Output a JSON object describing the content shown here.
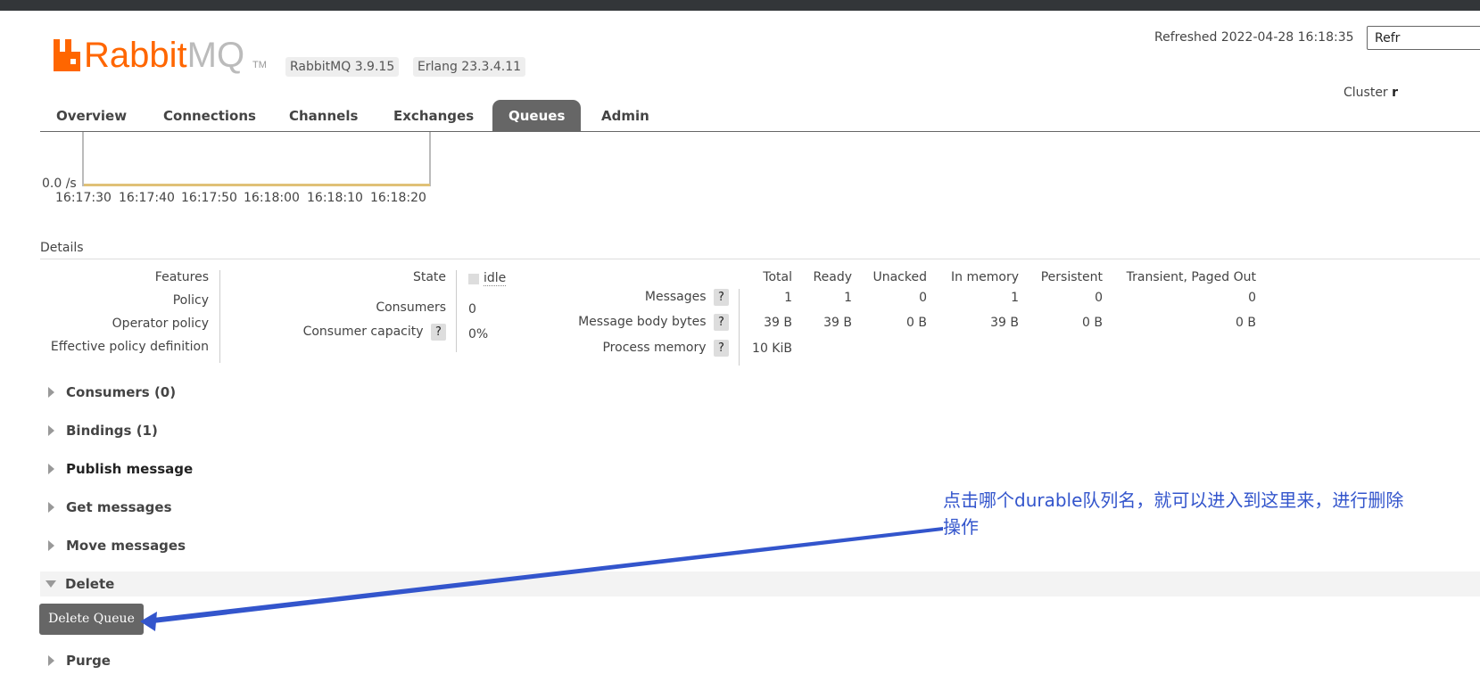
{
  "header": {
    "logo_text_rabbit": "Rabbit",
    "logo_text_mq": "MQ",
    "logo_tm": "TM",
    "rabbitmq_version": "RabbitMQ 3.9.15",
    "erlang_version": "Erlang 23.3.4.11",
    "refreshed": "Refreshed 2022-04-28 16:18:35",
    "refresh_button": "Refr",
    "cluster_label": "Cluster",
    "cluster_value": "r"
  },
  "nav": {
    "tabs": [
      {
        "label": "Overview"
      },
      {
        "label": "Connections"
      },
      {
        "label": "Channels"
      },
      {
        "label": "Exchanges"
      },
      {
        "label": "Queues",
        "active": true
      },
      {
        "label": "Admin"
      }
    ]
  },
  "chart_data": {
    "type": "line",
    "x": [
      "16:17:30",
      "16:17:40",
      "16:17:50",
      "16:18:00",
      "16:18:10",
      "16:18:20"
    ],
    "series": [
      {
        "values": [
          0,
          0,
          0,
          0,
          0,
          0
        ]
      }
    ],
    "y_tick_label": "0.0 /s",
    "line_color": "#e0c177"
  },
  "details": {
    "label": "Details",
    "left_labels": [
      "Features",
      "Policy",
      "Operator policy",
      "Effective policy definition"
    ],
    "state_label": "State",
    "state_value": "idle",
    "consumers_label": "Consumers",
    "consumers_value": "0",
    "consumer_capacity_label": "Consumer capacity",
    "consumer_capacity_value": "0%",
    "help_glyph": "?",
    "table_headers": [
      "Total",
      "Ready",
      "Unacked",
      "In memory",
      "Persistent",
      "Transient, Paged Out"
    ],
    "rows": [
      {
        "label": "Messages",
        "values": [
          "1",
          "1",
          "0",
          "1",
          "0",
          "0"
        ]
      },
      {
        "label": "Message body bytes",
        "values": [
          "39 B",
          "39 B",
          "0 B",
          "39 B",
          "0 B",
          "0 B"
        ]
      },
      {
        "label": "Process memory",
        "values": [
          "10 KiB"
        ]
      }
    ]
  },
  "sections": {
    "consumers": "Consumers (0)",
    "bindings": "Bindings (1)",
    "publish": "Publish message",
    "get": "Get messages",
    "move": "Move messages",
    "delete": "Delete",
    "purge": "Purge"
  },
  "delete_button": "Delete Queue",
  "annotation": {
    "text": "点击哪个durable队列名，就可以进入到这里来，进行删除操作",
    "color": "#3355cc"
  },
  "colors": {
    "brand": "#ff6600",
    "active_tab": "#666666",
    "annotation_arrow": "#3355cc"
  }
}
